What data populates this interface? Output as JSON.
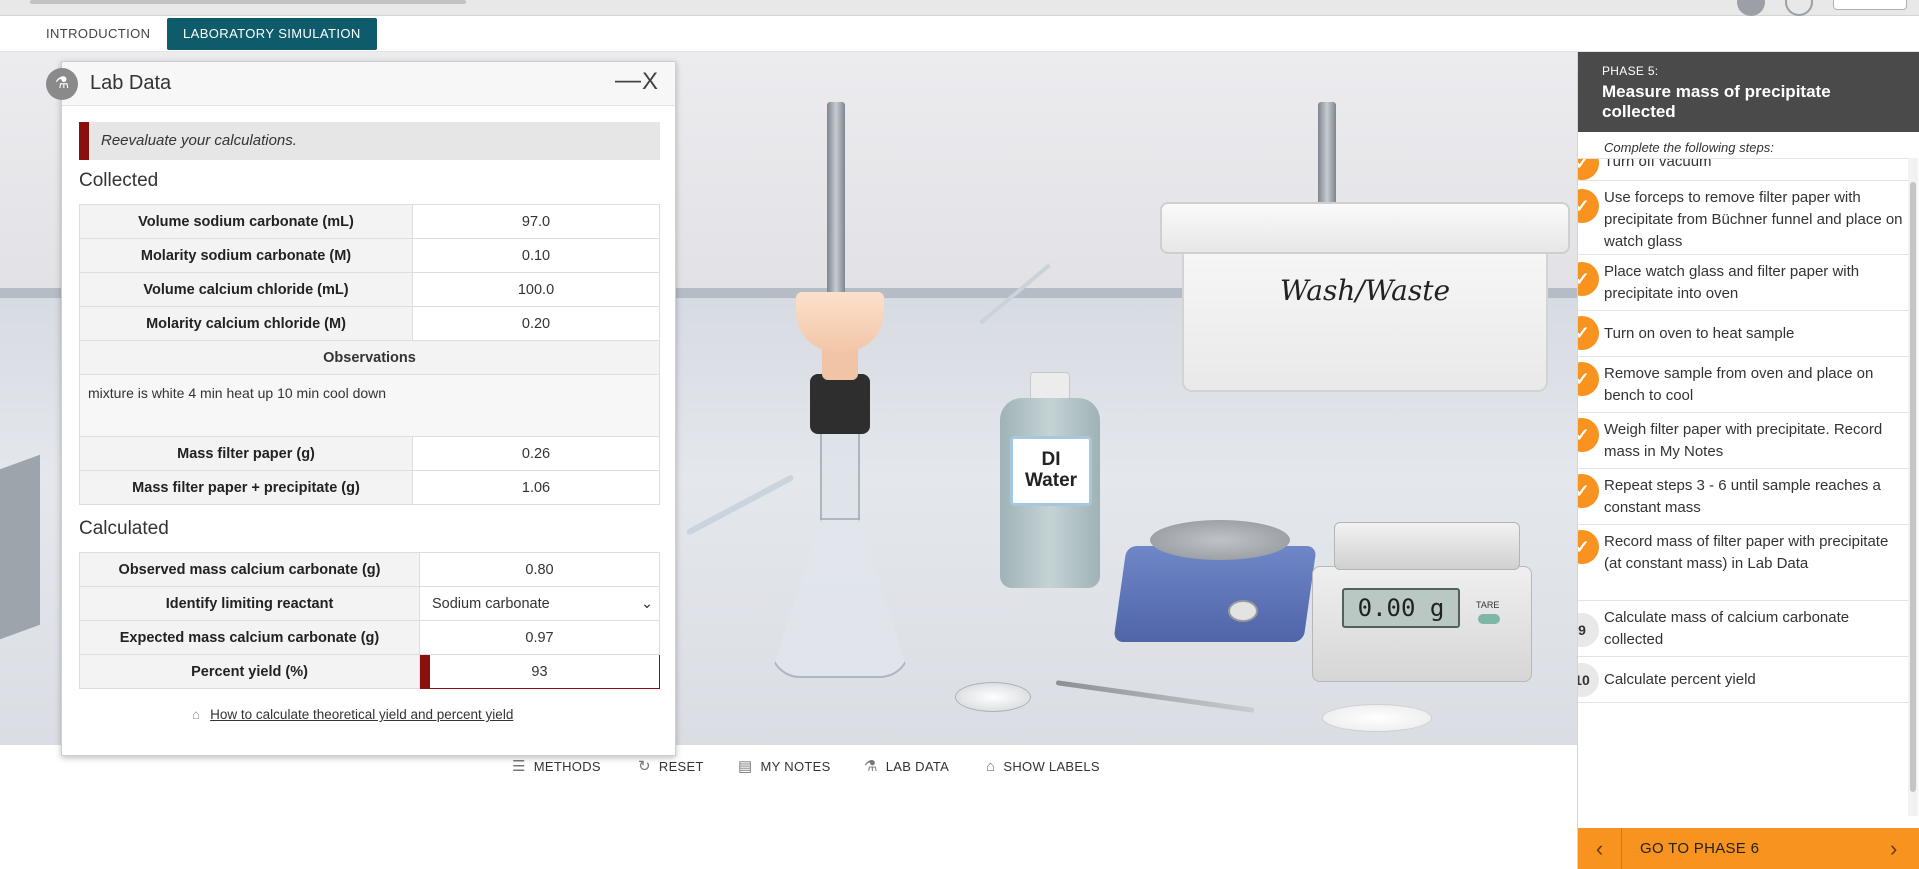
{
  "tabs": {
    "intro": "INTRODUCTION",
    "sim": "LABORATORY SIMULATION"
  },
  "scene": {
    "tub_label": "Wash/Waste",
    "bottle_label_1": "DI",
    "bottle_label_2": "Water",
    "balance_reading": "0.00 g",
    "tare_label": "TARE"
  },
  "toolbar": {
    "methods": "METHODS",
    "reset": "RESET",
    "notes": "MY NOTES",
    "labdata": "LAB DATA",
    "labels": "SHOW LABELS"
  },
  "panel": {
    "title": "Lab Data",
    "min_glyph": "—",
    "close_glyph": "X",
    "alert": "Reevaluate your calculations.",
    "collected_title": "Collected",
    "collected": [
      {
        "label": "Volume sodium carbonate (mL)",
        "value": "97.0"
      },
      {
        "label": "Molarity sodium carbonate (M)",
        "value": "0.10"
      },
      {
        "label": "Volume calcium chloride (mL)",
        "value": "100.0"
      },
      {
        "label": "Molarity calcium chloride (M)",
        "value": "0.20"
      }
    ],
    "observations_label": "Observations",
    "observations_text": "mixture is white 4 min heat up 10 min cool down",
    "mass": [
      {
        "label": "Mass filter paper (g)",
        "value": "0.26"
      },
      {
        "label": "Mass filter paper + precipitate (g)",
        "value": "1.06"
      }
    ],
    "calculated_title": "Calculated",
    "calculated": [
      {
        "label": "Observed mass calcium carbonate (g)",
        "value": "0.80"
      },
      {
        "label": "Identify limiting reactant",
        "value": "Sodium carbonate"
      },
      {
        "label": "Expected mass calcium carbonate (g)",
        "value": "0.97"
      },
      {
        "label": "Percent yield (%)",
        "value": "93"
      }
    ],
    "help_link": "How to calculate theoretical yield and percent yield"
  },
  "sidebar": {
    "phase": "PHASE 5:",
    "title": "Measure mass of precipitate collected",
    "subtitle": "Complete the following steps:",
    "steps": [
      {
        "status": "done",
        "text": "Turn off vacuum"
      },
      {
        "status": "done",
        "text": "Use forceps to remove filter paper with precipitate from Büchner funnel and place on watch glass"
      },
      {
        "status": "done",
        "text": "Place watch glass and filter paper with precipitate into oven"
      },
      {
        "status": "done",
        "text": "Turn on oven to heat sample"
      },
      {
        "status": "done",
        "text": "Remove sample from oven and place on bench to cool"
      },
      {
        "status": "done",
        "text": "Weigh filter paper with precipitate. Record mass in My Notes"
      },
      {
        "status": "done",
        "text": "Repeat steps 3 - 6 until sample reaches a constant mass"
      },
      {
        "status": "done",
        "text": "Record mass of filter paper with precipitate (at constant mass) in Lab Data"
      },
      {
        "status": "todo",
        "number": "9",
        "text": "Calculate mass of calcium carbonate collected"
      },
      {
        "status": "todo",
        "number": "10",
        "text": "Calculate percent yield"
      }
    ],
    "next_label": "GO TO PHASE 6"
  },
  "colors": {
    "accent": "#f7931e",
    "teal": "#0e5c6b",
    "error": "#8b0f0f"
  }
}
